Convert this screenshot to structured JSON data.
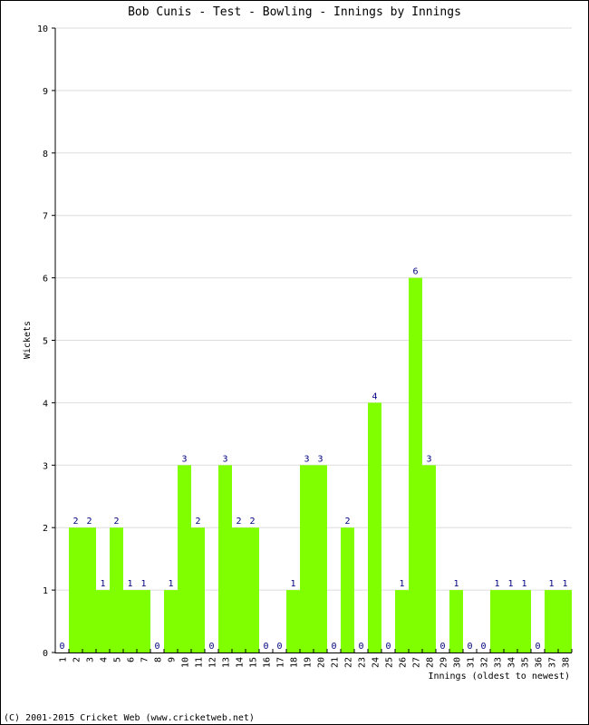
{
  "chart_data": {
    "type": "bar",
    "title": "Bob Cunis - Test - Bowling - Innings by Innings",
    "xlabel": "Innings (oldest to newest)",
    "ylabel": "Wickets",
    "ylim": [
      0,
      10
    ],
    "yticks": [
      "0",
      "1",
      "2",
      "3",
      "4",
      "5",
      "6",
      "7",
      "8",
      "9",
      "10"
    ],
    "grid": true,
    "bar_color": "#80ff00",
    "label_color": "#000080",
    "categories": [
      "1",
      "2",
      "3",
      "4",
      "5",
      "6",
      "7",
      "8",
      "9",
      "10",
      "11",
      "12",
      "13",
      "14",
      "15",
      "16",
      "17",
      "18",
      "19",
      "20",
      "21",
      "22",
      "23",
      "24",
      "25",
      "26",
      "27",
      "28",
      "29",
      "30",
      "31",
      "32",
      "33",
      "34",
      "35",
      "36",
      "37",
      "38"
    ],
    "values": [
      0,
      2,
      2,
      1,
      2,
      1,
      1,
      0,
      1,
      3,
      2,
      0,
      3,
      2,
      2,
      0,
      0,
      1,
      3,
      3,
      0,
      2,
      0,
      4,
      0,
      1,
      6,
      3,
      0,
      1,
      0,
      0,
      1,
      1,
      1,
      0,
      1,
      1
    ]
  },
  "footer": "(C) 2001-2015 Cricket Web (www.cricketweb.net)"
}
